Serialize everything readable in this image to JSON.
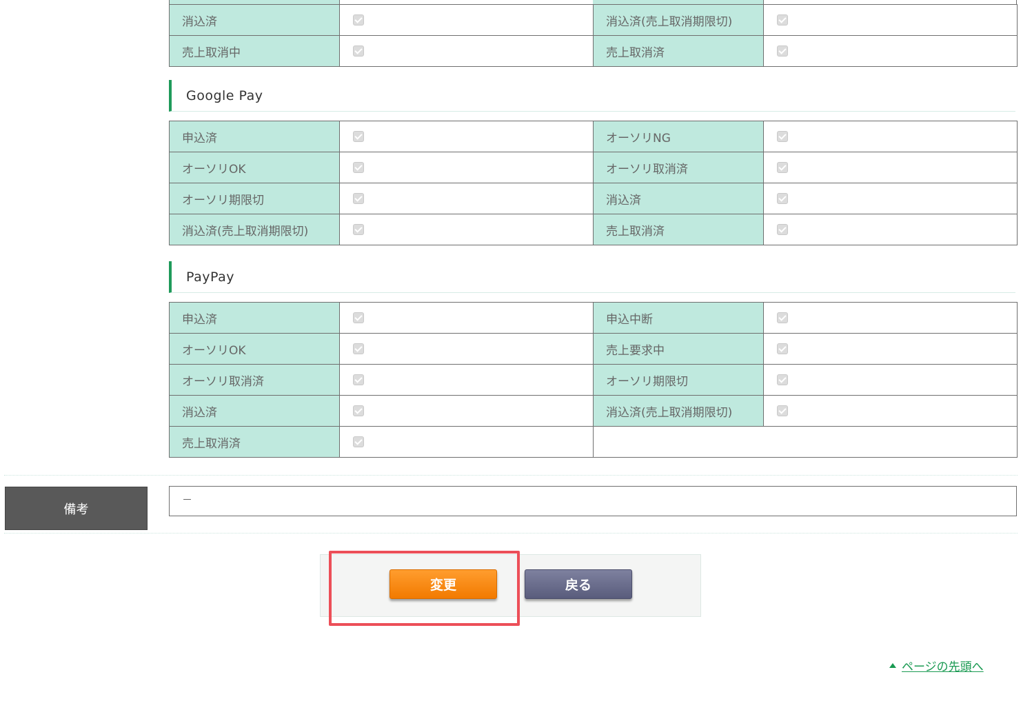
{
  "table_top": {
    "rows": [
      {
        "left_label": "消込済",
        "right_label": "消込済(売上取消期限切)"
      },
      {
        "left_label": "売上取消中",
        "right_label": "売上取消済"
      }
    ]
  },
  "googlepay": {
    "title": "Google Pay",
    "rows": [
      {
        "left_label": "申込済",
        "right_label": "オーソリNG"
      },
      {
        "left_label": "オーソリOK",
        "right_label": "オーソリ取消済"
      },
      {
        "left_label": "オーソリ期限切",
        "right_label": "消込済"
      },
      {
        "left_label": "消込済(売上取消期限切)",
        "right_label": "売上取消済"
      }
    ]
  },
  "paypay": {
    "title": "PayPay",
    "rows": [
      {
        "left_label": "申込済",
        "right_label": "申込中断"
      },
      {
        "left_label": "オーソリOK",
        "right_label": "売上要求中"
      },
      {
        "left_label": "オーソリ取消済",
        "right_label": "オーソリ期限切"
      },
      {
        "left_label": "消込済",
        "right_label": "消込済(売上取消期限切)"
      },
      {
        "left_label": "売上取消済",
        "right_label": ""
      }
    ]
  },
  "remarks": {
    "label": "備考",
    "value": "－"
  },
  "buttons": {
    "change": "変更",
    "back": "戻る"
  },
  "pagetop": {
    "label": "ページの先頭へ"
  },
  "colors": {
    "label_bg": "#bfe9de",
    "accent": "#1f9a5a",
    "change_btn": "#f27a00",
    "back_btn": "#595c7c",
    "highlight": "#ec4f58"
  }
}
